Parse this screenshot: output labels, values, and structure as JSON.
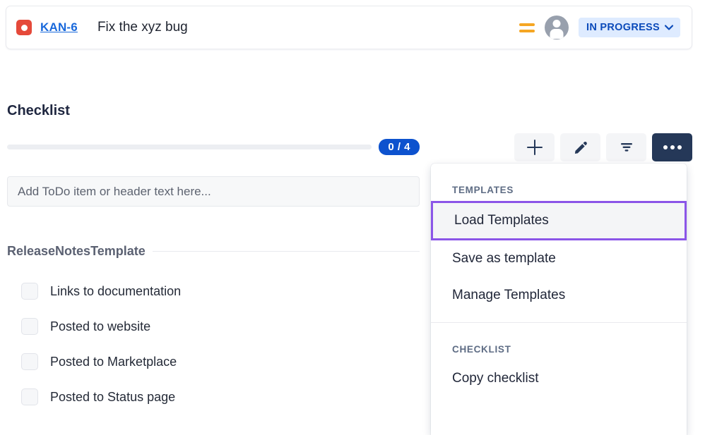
{
  "issue_header": {
    "type_icon": "bug-icon",
    "key": "KAN-6",
    "summary": "Fix the xyz bug",
    "priority_icon": "medium-priority-icon",
    "avatar_icon": "user-avatar-icon",
    "status": "IN PROGRESS",
    "status_chevron": "⌄",
    "colors": {
      "bug_red": "#e5493a",
      "key_blue": "#1868db",
      "priority_orange": "#f5a623",
      "status_bg": "#deebff",
      "status_text": "#0c4bba"
    }
  },
  "checklist": {
    "title": "Checklist",
    "progress_text": "0 / 4",
    "progress_percent": 0,
    "progress_color": "#0d52ce",
    "toolbar": {
      "add_icon": "plus-icon",
      "edit_icon": "pencil-icon",
      "filter_icon": "filter-icon",
      "more_icon": "ellipsis-icon"
    },
    "add_input_placeholder": "Add ToDo item or header text here...",
    "add_input_value": "",
    "section_header": "ReleaseNotesTemplate",
    "items": [
      {
        "label": "Links to documentation",
        "checked": false
      },
      {
        "label": "Posted to website",
        "checked": false
      },
      {
        "label": "Posted to Marketplace",
        "checked": false
      },
      {
        "label": "Posted to Status page",
        "checked": false
      }
    ]
  },
  "menu": {
    "templates_label": "TEMPLATES",
    "templates_items": [
      {
        "label": "Load Templates",
        "highlighted": true
      },
      {
        "label": "Save as template",
        "highlighted": false
      },
      {
        "label": "Manage Templates",
        "highlighted": false
      }
    ],
    "checklist_label": "CHECKLIST",
    "checklist_items": [
      {
        "label": "Copy checklist",
        "highlighted": false
      }
    ],
    "highlight_color": "#8b55e8"
  }
}
